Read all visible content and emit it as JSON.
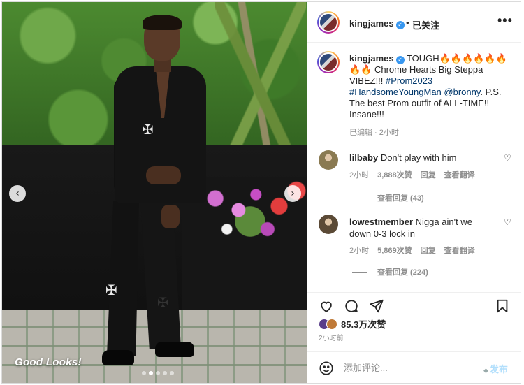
{
  "post": {
    "watermark": "Good Looks!",
    "carousel": {
      "slides": 5,
      "active_index": 1
    }
  },
  "header": {
    "username": "kingjames",
    "separator": "•",
    "follow_label": "已关注",
    "more_label": "•••"
  },
  "caption": {
    "username": "kingjames",
    "segments": [
      {
        "text": " TOUGH🔥🔥🔥🔥🔥🔥🔥🔥 Chrome Hearts Big Steppa VIBEZ!!! ",
        "type": "text"
      },
      {
        "text": "#Prom2023",
        "type": "tag"
      },
      {
        "text": " ",
        "type": "text"
      },
      {
        "text": "#HandsomeYoungMan",
        "type": "tag"
      },
      {
        "text": " ",
        "type": "text"
      },
      {
        "text": "@bronny",
        "type": "tag"
      },
      {
        "text": ". P.S. The best Prom outfit of ALL-TIME!! Insane!!!",
        "type": "text"
      }
    ],
    "meta": "已编辑 · 2小时"
  },
  "comments": [
    {
      "username": "lilbaby",
      "text": "Don't play with him",
      "time": "2小时",
      "likes": "3,888次赞",
      "reply_label": "回复",
      "translate_label": "查看翻译",
      "view_replies": "查看回复 (43)",
      "avatar_color": "#8a7a52"
    },
    {
      "username": "lowestmember",
      "text": "Nigga ain't we down 0-3 lock in",
      "time": "2小时",
      "likes": "5,869次赞",
      "reply_label": "回复",
      "translate_label": "查看翻译",
      "view_replies": "查看回复 (224)",
      "avatar_color": "#5b4a36"
    }
  ],
  "actions": {
    "icons": [
      "heart-icon",
      "comment-icon",
      "share-icon",
      "bookmark-icon"
    ]
  },
  "likes": {
    "count_label": "85.3万次赞",
    "avatar_colors": [
      "#5a3e8a",
      "#c07a38"
    ]
  },
  "posted_time": "2小时前",
  "composer": {
    "placeholder": "添加评论...",
    "post_label": "发布"
  },
  "colors": {
    "link": "#00376b",
    "verified": "#3897f0",
    "muted": "#8e8e8e",
    "post_button_disabled": "#b2dffc"
  }
}
